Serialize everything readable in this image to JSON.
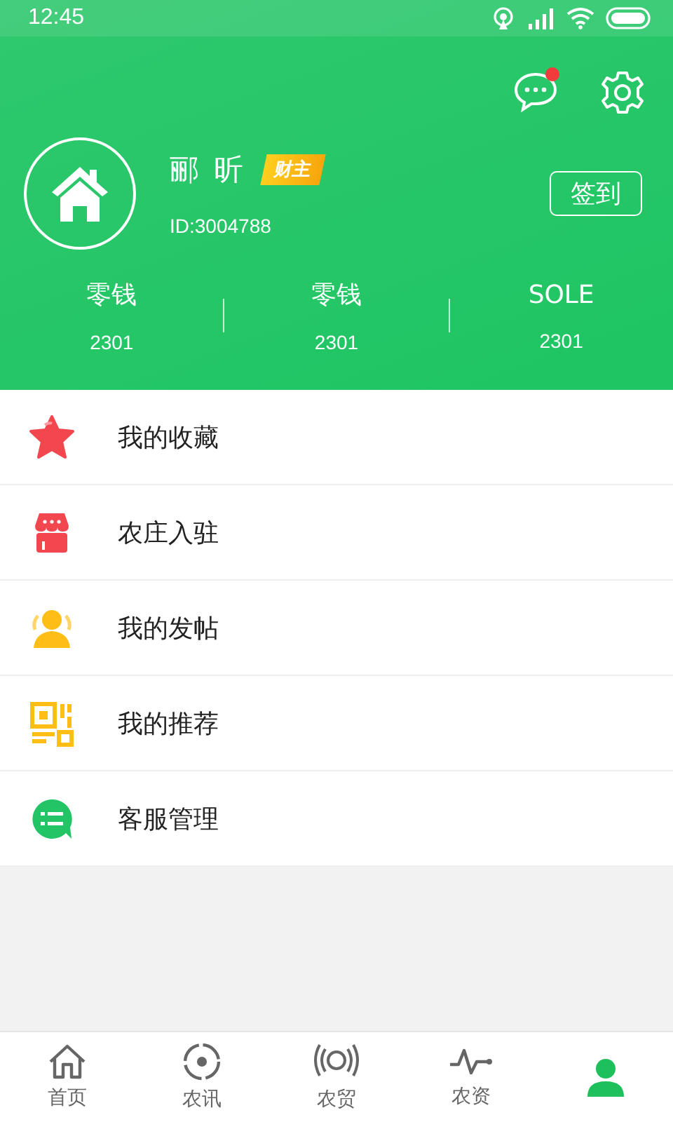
{
  "status_bar": {
    "time": "12:45"
  },
  "header": {
    "has_messages": true
  },
  "profile": {
    "name": "郦 昕",
    "badge": "财主",
    "id": "ID:3004788",
    "checkin_button": "签到"
  },
  "stats": [
    {
      "label": "零钱",
      "value": "2301"
    },
    {
      "label": "零钱",
      "value": "2301"
    },
    {
      "label": "SOLE",
      "value": "2301"
    }
  ],
  "menu": [
    {
      "kind": "star",
      "label": "我的收藏"
    },
    {
      "kind": "shop",
      "label": "农庄入驻"
    },
    {
      "kind": "people",
      "label": "我的发帖"
    },
    {
      "kind": "qr",
      "label": "我的推荐"
    },
    {
      "kind": "chat",
      "label": "客服管理"
    }
  ],
  "tab_bar": [
    {
      "kind": "home",
      "label": "首页",
      "selected": false
    },
    {
      "kind": "target",
      "label": "农讯",
      "selected": false
    },
    {
      "kind": "signal",
      "label": "农贸",
      "selected": false
    },
    {
      "kind": "pulse",
      "label": "农资",
      "selected": false
    },
    {
      "kind": "user",
      "selected": true
    }
  ]
}
